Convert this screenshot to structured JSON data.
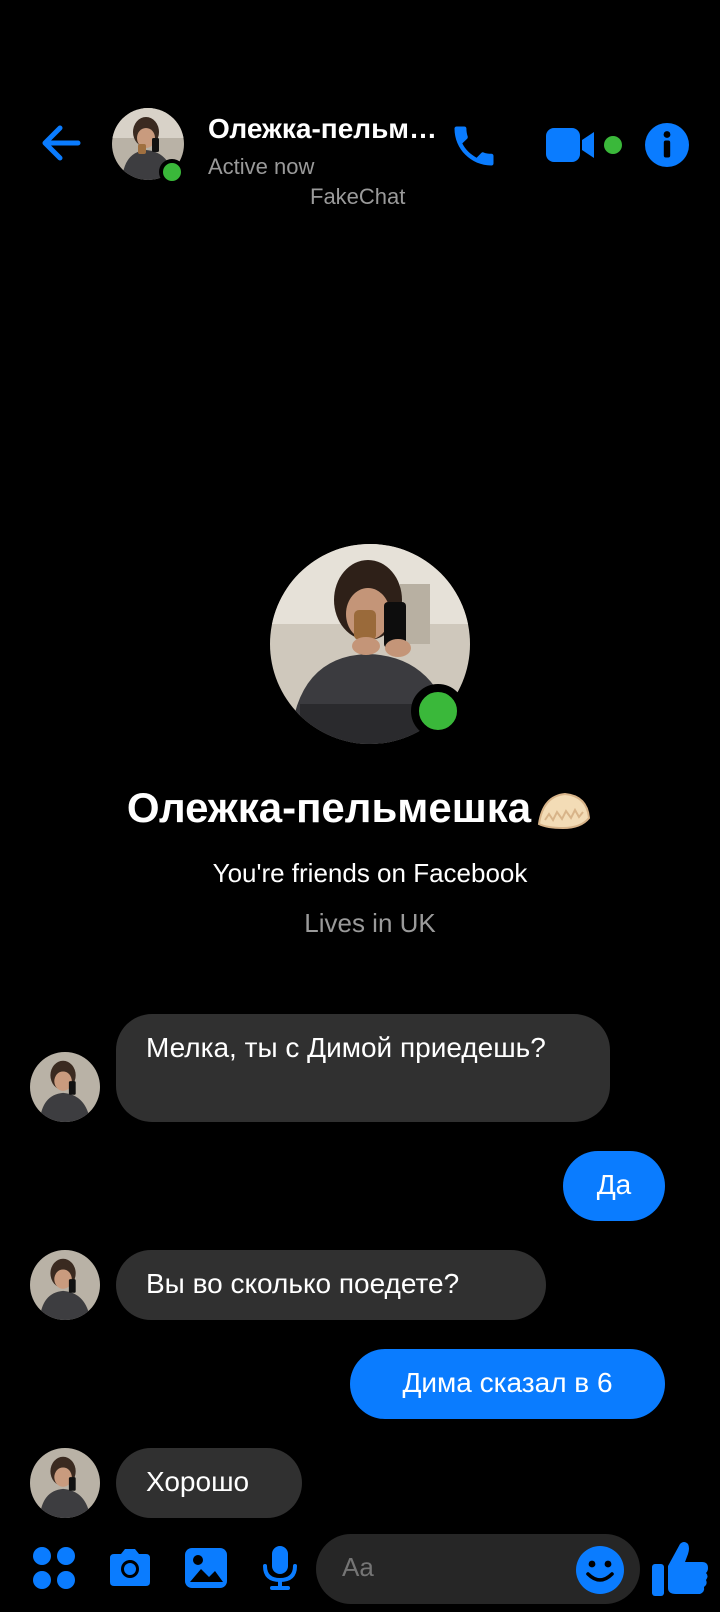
{
  "header": {
    "name": "Олежка-пельмешка🥟",
    "status": "Active now",
    "watermark": "FakeChat",
    "icons": [
      "back-arrow-icon",
      "phone-icon",
      "video-camera-icon",
      "info-icon"
    ],
    "accent_color": "#0a7cff",
    "online_color": "#3ab83a"
  },
  "profile": {
    "name": "Олежка-пельмешка",
    "emoji": "dumpling-emoji",
    "friends_text": "You're friends on Facebook",
    "lives_text": "Lives in UK"
  },
  "messages": [
    {
      "direction": "in",
      "text": "Мелка, ты с Димой приедешь?"
    },
    {
      "direction": "out",
      "text": "Да"
    },
    {
      "direction": "in",
      "text": "Вы во сколько поедете?"
    },
    {
      "direction": "out",
      "text": "Дима сказал в 6"
    },
    {
      "direction": "in",
      "text": "Хорошо"
    }
  ],
  "composer": {
    "placeholder": "Aa",
    "icons": [
      "apps-icon",
      "camera-icon",
      "gallery-icon",
      "microphone-icon",
      "emoji-icon",
      "thumbs-up-icon"
    ]
  },
  "colors": {
    "background": "#000000",
    "incoming_bubble": "#303030",
    "outgoing_bubble": "#0a7cff",
    "secondary_text": "#9a9a9a"
  }
}
